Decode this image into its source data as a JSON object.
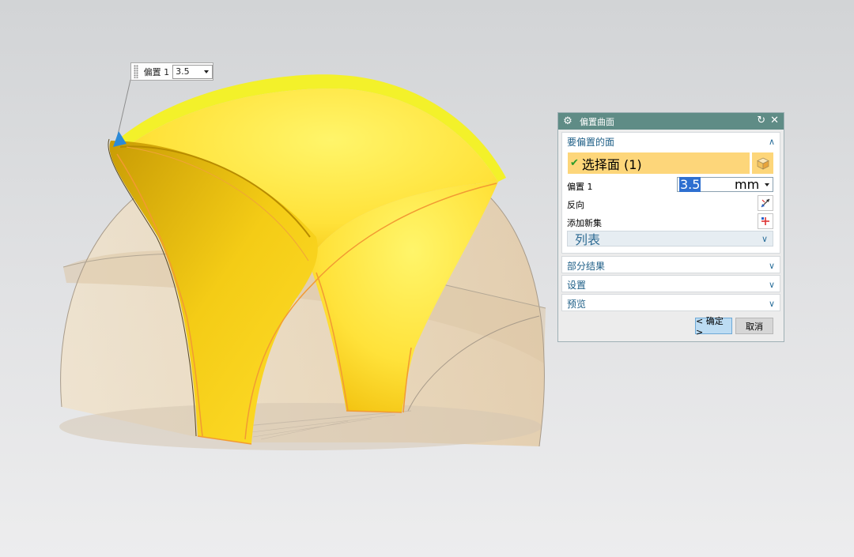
{
  "handle": {
    "label": "偏置 1",
    "value": "3.5"
  },
  "dialog": {
    "title": "偏置曲面",
    "sections": {
      "faces": {
        "label": "要偏置的面"
      },
      "partial": {
        "label": "部分结果"
      },
      "settings": {
        "label": "设置"
      },
      "preview": {
        "label": "预览"
      }
    },
    "select_face": "选择面 (1)",
    "offset_label": "偏置 1",
    "offset_value": "3.5",
    "offset_unit": "mm",
    "reverse_label": "反向",
    "add_set_label": "添加新集",
    "list_label": "列表",
    "ok_label": "< 确定 >",
    "cancel_label": "取消"
  },
  "colors": {
    "title_bar": "#5f8c86",
    "selection": "#fdd67a",
    "surface": "#ffe93a",
    "shell": "#ecd7b4"
  },
  "icons": [
    "gear-icon",
    "reset-icon",
    "close-icon",
    "check-icon",
    "cube-icon",
    "reverse-direction-icon",
    "add-set-icon",
    "chevron-up-icon",
    "chevron-down-icon"
  ]
}
